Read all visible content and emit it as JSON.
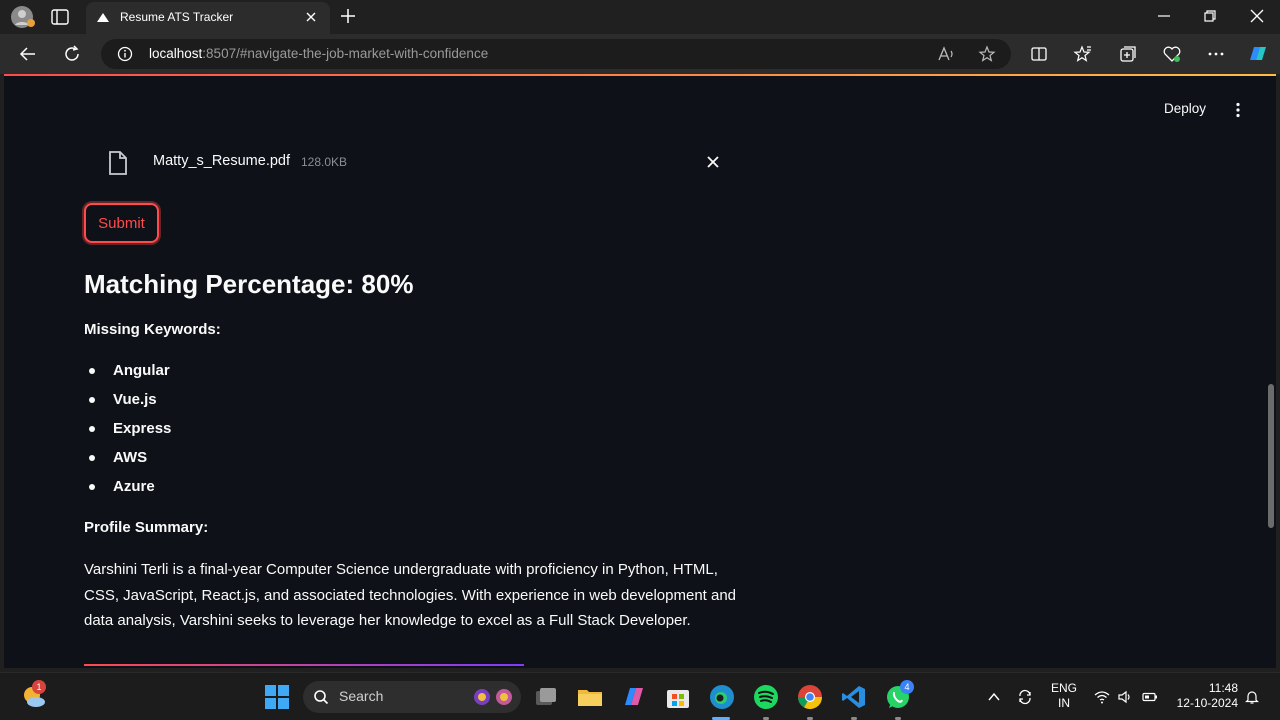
{
  "browser": {
    "tab_title": "Resume ATS Tracker",
    "url_host": "localhost",
    "url_rest": ":8507/#navigate-the-job-market-with-confidence"
  },
  "app": {
    "deploy_label": "Deploy",
    "file": {
      "name": "Matty_s_Resume.pdf",
      "size": "128.0KB"
    },
    "submit_label": "Submit",
    "matching_heading": "Matching Percentage: 80%",
    "missing_keywords_label": "Missing Keywords:",
    "missing_keywords": [
      "Angular",
      "Vue.js",
      "Express",
      "AWS",
      "Azure"
    ],
    "profile_summary_label": "Profile Summary:",
    "profile_summary": "Varshini Terli is a final-year Computer Science undergraduate with proficiency in Python, HTML, CSS, JavaScript, React.js, and associated technologies. With experience in web development and data analysis, Varshini seeks to leverage her knowledge to excel as a Full Stack Developer."
  },
  "taskbar": {
    "search_placeholder": "Search",
    "notification_badge_weather": "1",
    "whatsapp_badge": "4",
    "lang_primary": "ENG",
    "lang_secondary": "IN",
    "time": "11:48",
    "date": "12-10-2024"
  },
  "colors": {
    "accent": "#ff4b4b",
    "app_bg": "#0e1117",
    "text": "#fafafa"
  }
}
